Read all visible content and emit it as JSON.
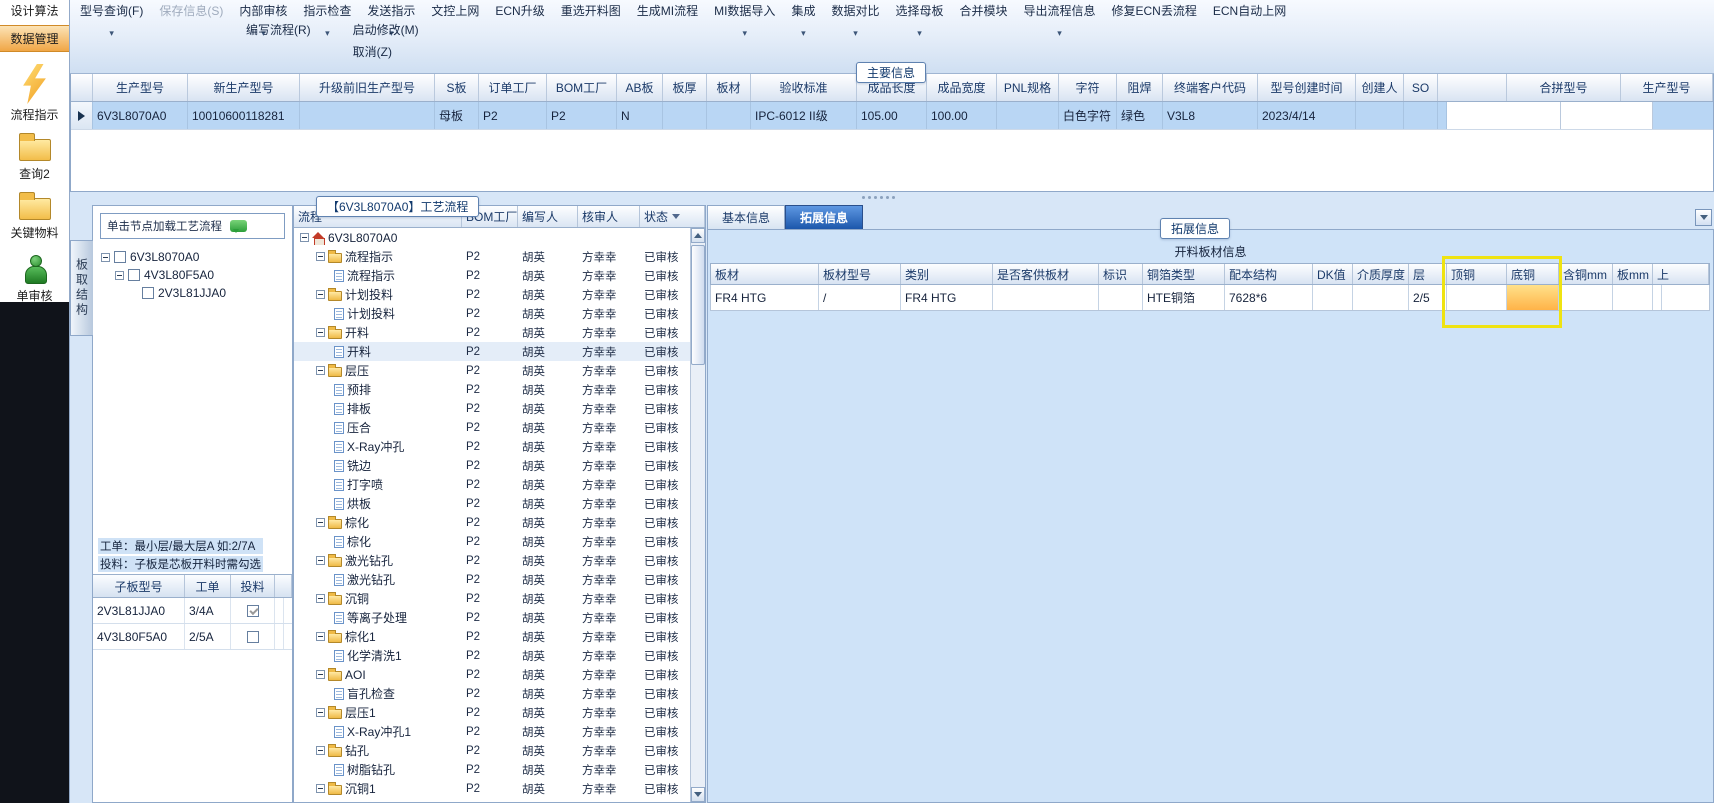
{
  "colors": {
    "accent_blue": "#1c57ab",
    "selected_row": "#b9d6f4",
    "highlight_yellow": "#efe311",
    "cell_orange": "#ffb348",
    "sidebar_orange": "#f0a646",
    "status_green": "#2c9e3a"
  },
  "toolbar": {
    "row1": [
      {
        "label": "型号查询(F)",
        "caret": true
      },
      {
        "label": "保存信息(S)",
        "disabled": true
      },
      {
        "label": "内部审核",
        "caret": true
      },
      {
        "label": "指示检查",
        "caret": true
      },
      {
        "label": "发送指示",
        "caret": true
      },
      {
        "label": "文控上网"
      },
      {
        "label": "ECN升级"
      },
      {
        "label": "重选开料图"
      },
      {
        "label": "生成MI流程"
      },
      {
        "label": "MI数据导入",
        "caret": true
      },
      {
        "label": "集成",
        "caret": true
      },
      {
        "label": "数据对比",
        "caret": true
      },
      {
        "label": "选择母板",
        "caret": true
      },
      {
        "label": "合并模块"
      },
      {
        "label": "导出流程信息",
        "caret": true
      },
      {
        "label": "修复ECN丢流程"
      },
      {
        "label": "ECN自动上网"
      }
    ],
    "row2": [
      "编写流程(R)",
      "启动修改(M)",
      "取消(Z)"
    ]
  },
  "sidebar": {
    "items": [
      {
        "label": "设计算法",
        "icon": "none"
      },
      {
        "label": "数据管理",
        "icon": "none",
        "style": "orange"
      },
      {
        "label": "流程指示",
        "icon": "lightning"
      },
      {
        "label": "查询2",
        "icon": "folder"
      },
      {
        "label": "关键物料",
        "icon": "folder"
      },
      {
        "label": "单审核",
        "icon": "person"
      }
    ]
  },
  "main_grid": {
    "title": "主要信息",
    "columns": [
      "生产型号",
      "新生产型号",
      "升级前旧生产型号",
      "S板",
      "订单工厂",
      "BOM工厂",
      "AB板",
      "板厚",
      "板材",
      "验收标准",
      "成品长度",
      "成品宽度",
      "PNL规格",
      "字符",
      "阻焊",
      "终端客户代码",
      "型号创建时间",
      "创建人",
      "SO"
    ],
    "row": [
      "6V3L8070A0",
      "10010600118281",
      "",
      "母板",
      "P2",
      "P2",
      "N",
      "",
      "",
      "IPC-6012 II级",
      "105.00",
      "100.00",
      "",
      "白色字符",
      "绿色",
      "V3L8",
      "2023/4/14",
      "",
      ""
    ],
    "right_columns": [
      "合拼型号",
      "生产型号"
    ]
  },
  "nav_panel": {
    "vertical_tab": "板取结构",
    "hint": "单击节点加载工艺流程",
    "tree": [
      "6V3L8070A0",
      "4V3L80F5A0",
      "2V3L81JJA0"
    ],
    "note1": "工单：最小层/最大层A 如:2/7A",
    "note2": "投料：子板是芯板开料时需勾选",
    "sub_table": {
      "columns": [
        "子板型号",
        "工单",
        "投料"
      ],
      "rows": [
        {
          "model": "2V3L81JJA0",
          "order": "3/4A",
          "feed": true
        },
        {
          "model": "4V3L80F5A0",
          "order": "2/5A",
          "feed": false
        }
      ]
    }
  },
  "process_panel": {
    "title": "【6V3L8070A0】工艺流程",
    "columns": [
      "流程",
      "BOM工厂",
      "编写人",
      "核审人",
      "状态"
    ],
    "default_cells": [
      "P2",
      "胡英",
      "方幸幸",
      "已审核"
    ],
    "highlight_row": 6,
    "rows": [
      [
        "root",
        "6V3L8070A0"
      ],
      [
        "folder",
        "流程指示"
      ],
      [
        "doc",
        "流程指示"
      ],
      [
        "folder",
        "计划投料"
      ],
      [
        "doc",
        "计划投料"
      ],
      [
        "folder",
        "开料"
      ],
      [
        "doc",
        "开料"
      ],
      [
        "folder",
        "层压"
      ],
      [
        "doc",
        "预排"
      ],
      [
        "doc",
        "排板"
      ],
      [
        "doc",
        "压合"
      ],
      [
        "doc",
        "X-Ray冲孔"
      ],
      [
        "doc",
        "铣边"
      ],
      [
        "doc",
        "打字喷"
      ],
      [
        "doc",
        "烘板"
      ],
      [
        "folder",
        "棕化"
      ],
      [
        "doc",
        "棕化"
      ],
      [
        "folder",
        "激光钻孔"
      ],
      [
        "doc",
        "激光钻孔"
      ],
      [
        "folder",
        "沉铜"
      ],
      [
        "doc",
        "等离子处理"
      ],
      [
        "folder",
        "棕化1"
      ],
      [
        "doc",
        "化学清洗1"
      ],
      [
        "folder",
        "AOI"
      ],
      [
        "doc",
        "盲孔检查"
      ],
      [
        "folder",
        "层压1"
      ],
      [
        "doc",
        "X-Ray冲孔1"
      ],
      [
        "folder",
        "钻孔"
      ],
      [
        "doc",
        "树脂钻孔"
      ],
      [
        "folder",
        "沉铜1"
      ]
    ]
  },
  "detail_panel": {
    "tabs": [
      "基本信息",
      "拓展信息"
    ],
    "active_tab": "拓展信息",
    "badge": "拓展信息",
    "section_title": "开料板材信息",
    "columns": [
      "板材",
      "板材型号",
      "类别",
      "是否客供板材",
      "标识",
      "铜箔类型",
      "配本结构",
      "DK值",
      "介质厚度",
      "层",
      "顶铜",
      "底铜",
      "含铜mm",
      "板mm",
      "上"
    ],
    "row": [
      "FR4 HTG",
      "/",
      "FR4 HTG",
      "",
      "",
      "HTE铜箔",
      "7628*6",
      "",
      "",
      "2/5",
      "",
      "",
      "",
      "",
      ""
    ],
    "highlight_columns": [
      "顶铜",
      "底铜"
    ]
  }
}
